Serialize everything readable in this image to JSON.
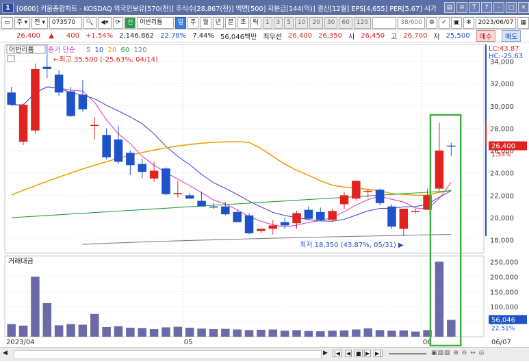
{
  "window": {
    "badge": "1",
    "title": "[0600] 키움종합차트 - KOSDAQ 외국인보유[570(천)] 주식수[28,867(천)] 액면[500] 자본금[144(억)] 결산[12월] EPS[4,655] PER[5.67] 시가",
    "controls": [
      "▤",
      "≡",
      "T",
      "?",
      "-",
      "□",
      "×"
    ]
  },
  "toolbar": {
    "type_label": "주",
    "all_label": "전",
    "code": "073570",
    "search_icon": "🔍",
    "new_label": "신",
    "stock_name": "어반리튬",
    "periods": [
      "일",
      "주",
      "월",
      "년",
      "분",
      "초",
      "틱"
    ],
    "selected_period": "일",
    "minutes": [
      "1",
      "3",
      "5",
      "10",
      "20",
      "30",
      "60",
      "120"
    ],
    "count": "38/600",
    "date": "2023/06/07"
  },
  "quote": {
    "price": "26,400",
    "arrow": "▲",
    "change": "400",
    "change_pct": "+1.54%",
    "volume": "2,146,862",
    "turnover_pct": "22.78%",
    "ratio": "7.44%",
    "amount": "56,046백만",
    "best_ask_label": "최우선",
    "best_ask": "26,400",
    "best_bid": "26,350",
    "open_label": "시",
    "open": "26,450",
    "high_label": "고",
    "high": "26,700",
    "low_label": "저",
    "low": "25,500",
    "buy_label": "매수",
    "sell_label": "매도"
  },
  "chart_data": {
    "type": "candlestick",
    "stock_label": "어반리튬",
    "legend": {
      "price_label": "종가 단순",
      "ma_periods": [
        "5",
        "10",
        "20",
        "60",
        "120"
      ],
      "ma_colors": [
        "#e040c0",
        "#4050d0",
        "#f0a000",
        "#20a040",
        "#808080"
      ]
    },
    "price_axis": {
      "min": 17000,
      "max": 35500,
      "ticks": [
        "34,000",
        "32,000",
        "30,000",
        "28,000",
        "26,000",
        "24,000",
        "22,000",
        "20,000",
        "18,000"
      ]
    },
    "lc_label": "LC:43.87",
    "hc_label": "HC:-25.63",
    "current_price": "26,400",
    "current_pct": "1.54%",
    "high_annotation": "최고 35,500 (-25.63%, 04/14)",
    "low_annotation": "최저 18,350 (43.87%, 05/31)",
    "x_labels": [
      "2023/04",
      "05",
      "06",
      "06/07"
    ],
    "candles": [
      {
        "o": 31200,
        "h": 31700,
        "l": 30000,
        "c": 30100
      },
      {
        "o": 26800,
        "h": 30200,
        "l": 26500,
        "c": 30100
      },
      {
        "o": 27800,
        "h": 33800,
        "l": 27500,
        "c": 33300
      },
      {
        "o": 33500,
        "h": 35500,
        "l": 32500,
        "c": 33300
      },
      {
        "o": 32800,
        "h": 33200,
        "l": 30900,
        "c": 31200
      },
      {
        "o": 31300,
        "h": 31700,
        "l": 29000,
        "c": 29100
      },
      {
        "o": 31000,
        "h": 32300,
        "l": 29500,
        "c": 29700
      },
      {
        "o": 28300,
        "h": 29000,
        "l": 27000,
        "c": 28300
      },
      {
        "o": 27400,
        "h": 28000,
        "l": 25200,
        "c": 25400
      },
      {
        "o": 27000,
        "h": 28200,
        "l": 24800,
        "c": 25000
      },
      {
        "o": 25800,
        "h": 26000,
        "l": 23800,
        "c": 24700
      },
      {
        "o": 24800,
        "h": 25300,
        "l": 23500,
        "c": 24100
      },
      {
        "o": 23500,
        "h": 25000,
        "l": 23200,
        "c": 24200
      },
      {
        "o": 24400,
        "h": 24500,
        "l": 22000,
        "c": 22100
      },
      {
        "o": 22200,
        "h": 23300,
        "l": 21800,
        "c": 22200
      },
      {
        "o": 22000,
        "h": 22200,
        "l": 21700,
        "c": 21700
      },
      {
        "o": 21500,
        "h": 22300,
        "l": 21000,
        "c": 21000
      },
      {
        "o": 21000,
        "h": 21300,
        "l": 20800,
        "c": 20900
      },
      {
        "o": 21000,
        "h": 21400,
        "l": 20200,
        "c": 20300
      },
      {
        "o": 20500,
        "h": 20700,
        "l": 19600,
        "c": 19600
      },
      {
        "o": 20200,
        "h": 20400,
        "l": 18500,
        "c": 18600
      },
      {
        "o": 18800,
        "h": 19000,
        "l": 18600,
        "c": 19000
      },
      {
        "o": 19000,
        "h": 19800,
        "l": 18500,
        "c": 19300
      },
      {
        "o": 19600,
        "h": 20000,
        "l": 19000,
        "c": 19300
      },
      {
        "o": 19500,
        "h": 20600,
        "l": 19000,
        "c": 20400
      },
      {
        "o": 20700,
        "h": 21000,
        "l": 19800,
        "c": 19900
      },
      {
        "o": 20500,
        "h": 20900,
        "l": 19700,
        "c": 19800
      },
      {
        "o": 19800,
        "h": 20800,
        "l": 19600,
        "c": 20600
      },
      {
        "o": 21200,
        "h": 22300,
        "l": 20800,
        "c": 22000
      },
      {
        "o": 21700,
        "h": 23300,
        "l": 21500,
        "c": 23300
      },
      {
        "o": 22400,
        "h": 22500,
        "l": 21800,
        "c": 22400
      },
      {
        "o": 22500,
        "h": 22600,
        "l": 21100,
        "c": 21300
      },
      {
        "o": 21000,
        "h": 21200,
        "l": 19000,
        "c": 19200
      },
      {
        "o": 19000,
        "h": 20800,
        "l": 18350,
        "c": 20800
      },
      {
        "o": 20600,
        "h": 20800,
        "l": 20400,
        "c": 20600
      },
      {
        "o": 20700,
        "h": 22600,
        "l": 20700,
        "c": 22000
      },
      {
        "o": 22600,
        "h": 28500,
        "l": 22400,
        "c": 26000
      },
      {
        "o": 26450,
        "h": 26700,
        "l": 25500,
        "c": 26400
      }
    ],
    "volume_label": "거래대금",
    "volume_axis": {
      "max": 265000,
      "ticks": [
        "250,000",
        "200,000",
        "150,000",
        "100,000",
        "50,000"
      ]
    },
    "volume_current": "56,046",
    "volume_pct": "22.51%",
    "volumes": [
      42000,
      37000,
      200000,
      112000,
      38000,
      42000,
      40000,
      76000,
      32000,
      35000,
      30000,
      29000,
      25000,
      31000,
      33000,
      30000,
      27000,
      25000,
      26000,
      24000,
      22000,
      23000,
      24000,
      20000,
      22000,
      19000,
      18000,
      20000,
      21000,
      24000,
      28000,
      22000,
      20000,
      21000,
      17000,
      22000,
      250000,
      56046
    ],
    "highlight_color": "#40b040"
  },
  "scrollbar": {
    "left": "◀",
    "right": "▶",
    "nav": [
      "|◀",
      "◀",
      "■",
      "▶",
      "▶|"
    ]
  }
}
